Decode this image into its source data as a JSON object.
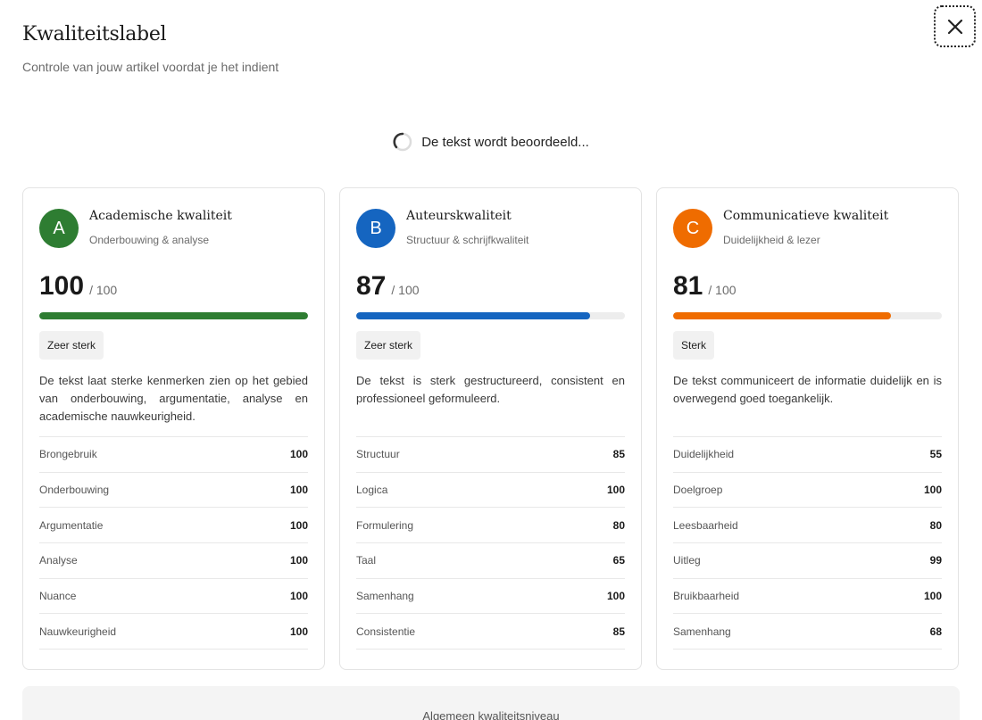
{
  "header": {
    "title": "Kwaliteitslabel",
    "subtitle": "Controle van jouw artikel voordat je het indient"
  },
  "loading": {
    "text": "De tekst wordt beoordeeld..."
  },
  "cards": [
    {
      "grade": "A",
      "color": "#2e7d32",
      "title": "Academische kwaliteit",
      "subtitle": "Onderbouwing & analyse",
      "score": "100",
      "score_max": "/ 100",
      "progress": 1.0,
      "badge": "Zeer sterk",
      "description": "De tekst laat sterke kenmerken zien op het gebied van onderbouwing, argumentatie, analyse en academische nauwkeurigheid.",
      "metrics": [
        {
          "name": "Brongebruik",
          "value": "100"
        },
        {
          "name": "Onderbouwing",
          "value": "100"
        },
        {
          "name": "Argumentatie",
          "value": "100"
        },
        {
          "name": "Analyse",
          "value": "100"
        },
        {
          "name": "Nuance",
          "value": "100"
        },
        {
          "name": "Nauwkeurigheid",
          "value": "100"
        }
      ]
    },
    {
      "grade": "B",
      "color": "#1565c0",
      "title": "Auteurskwaliteit",
      "subtitle": "Structuur & schrijfkwaliteit",
      "score": "87",
      "score_max": "/ 100",
      "progress": 0.87,
      "badge": "Zeer sterk",
      "description": "De tekst is sterk gestructureerd, consistent en professioneel geformuleerd.",
      "metrics": [
        {
          "name": "Structuur",
          "value": "85"
        },
        {
          "name": "Logica",
          "value": "100"
        },
        {
          "name": "Formulering",
          "value": "80"
        },
        {
          "name": "Taal",
          "value": "65"
        },
        {
          "name": "Samenhang",
          "value": "100"
        },
        {
          "name": "Consistentie",
          "value": "85"
        }
      ]
    },
    {
      "grade": "C",
      "color": "#ef6c00",
      "title": "Communicatieve kwaliteit",
      "subtitle": "Duidelijkheid & lezer",
      "score": "81",
      "score_max": "/ 100",
      "progress": 0.81,
      "badge": "Sterk",
      "description": "De tekst communiceert de informatie duidelijk en is overwegend goed toegankelijk.",
      "metrics": [
        {
          "name": "Duidelijkheid",
          "value": "55"
        },
        {
          "name": "Doelgroep",
          "value": "100"
        },
        {
          "name": "Leesbaarheid",
          "value": "80"
        },
        {
          "name": "Uitleg",
          "value": "99"
        },
        {
          "name": "Bruikbaarheid",
          "value": "100"
        },
        {
          "name": "Samenhang",
          "value": "68"
        }
      ]
    }
  ],
  "overall": {
    "label": "Algemeen kwaliteitsniveau"
  },
  "icons": {
    "close": "close-icon",
    "spinner": "spinner-icon"
  }
}
